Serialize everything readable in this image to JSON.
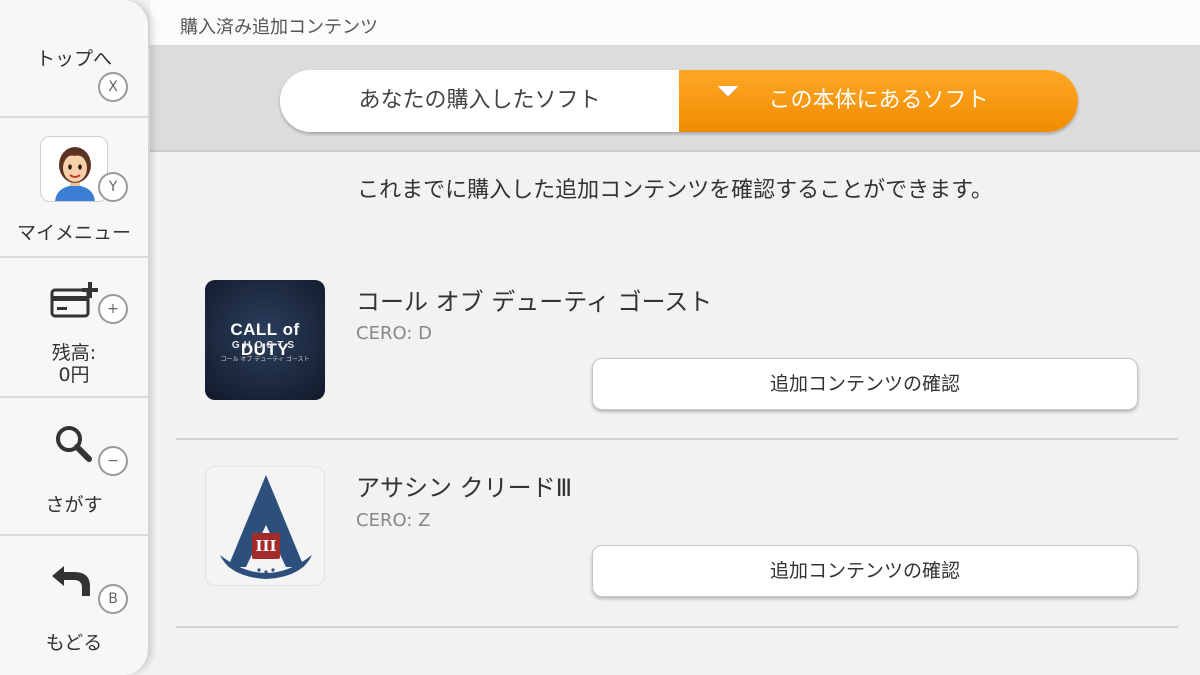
{
  "header": {
    "title": "購入済み追加コンテンツ"
  },
  "tabs": [
    {
      "label": "あなたの購入したソフト",
      "active": false
    },
    {
      "label": "この本体にあるソフト",
      "active": true
    }
  ],
  "sidebar": {
    "top": {
      "label": "トップへ",
      "button": "X"
    },
    "mymenu": {
      "label": "マイメニュー",
      "button": "Y"
    },
    "balance": {
      "label": "残高:",
      "value": "0円",
      "button": "+"
    },
    "search": {
      "label": "さがす",
      "button": "−"
    },
    "back": {
      "label": "もどる",
      "button": "B"
    }
  },
  "intro": "これまでに購入した追加コンテンツを確認することができます。",
  "items": [
    {
      "title": "コール オブ デューティ ゴースト",
      "rating": "CERO: D",
      "button": "追加コンテンツの確認",
      "art": {
        "line1": "CALL of DUTY",
        "line2": "GHOSTS",
        "line3": "コール オブ デューティ ゴースト"
      }
    },
    {
      "title": "アサシン クリードⅢ",
      "rating": "CERO: Z",
      "button": "追加コンテンツの確認",
      "art": {
        "numeral": "III"
      }
    }
  ],
  "colors": {
    "accent": "#f59300",
    "accent_light": "#ffa726",
    "assassin_blue": "#2d4f7c",
    "assassin_red": "#a52a2a"
  },
  "icons": [
    "credit-card-plus-icon",
    "search-icon",
    "back-arrow-icon"
  ]
}
